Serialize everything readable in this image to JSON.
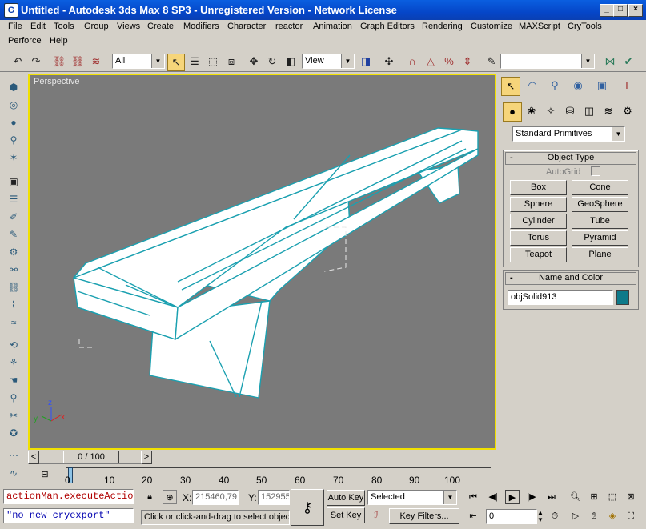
{
  "window": {
    "title": "Untitled - Autodesk 3ds Max 8 SP3  - Unregistered Version - Network License",
    "app_icon": "3ds-max-logo-icon",
    "minimize": "_",
    "maximize": "□",
    "close": "×"
  },
  "menu_row1": [
    "File",
    "Edit",
    "Tools",
    "Group",
    "Views",
    "Create",
    "Modifiers",
    "Character",
    "reactor",
    "Animation",
    "Graph Editors",
    "Rendering",
    "Customize",
    "MAXScript",
    "CryTools"
  ],
  "menu_row2": [
    "Perforce",
    "Help"
  ],
  "toolbar": {
    "selection_filter": "All",
    "reference_coord": "View",
    "named_selection": ""
  },
  "viewport": {
    "label": "Perspective",
    "axis_x": "x",
    "axis_y": "y",
    "axis_z": "z",
    "border_color": "#f0e000",
    "bg_color": "#7a7a7a",
    "object_color": "#ffffff",
    "edge_color": "#1aa0b0"
  },
  "command_panel": {
    "category_dropdown": "Standard Primitives",
    "object_type_title": "Object Type",
    "autogrid_label": "AutoGrid",
    "buttons": [
      "Box",
      "Cone",
      "Sphere",
      "GeoSphere",
      "Cylinder",
      "Tube",
      "Torus",
      "Pyramid",
      "Teapot",
      "Plane"
    ],
    "name_color_title": "Name and Color",
    "object_name": "objSolid913",
    "object_color": "#0e7a8a"
  },
  "time_slider": {
    "frame_display": "0 / 100",
    "prev": "<",
    "next": ">"
  },
  "trackbar": {
    "ticks": [
      "0",
      "10",
      "20",
      "30",
      "40",
      "50",
      "60",
      "70",
      "80",
      "90",
      "100"
    ]
  },
  "status": {
    "maxscript_line1": "actionMan.executeActio",
    "maxscript_line2": "\"no new cryexport\"",
    "x_label": "X:",
    "x_value": "215460,79",
    "y_label": "Y:",
    "y_value": "152955",
    "prompt": "Click or click-and-drag to select object",
    "auto_key": "Auto Key",
    "set_key": "Set Key",
    "selected_dropdown": "Selected",
    "key_filters": "Key Filters...",
    "frame_field": "0"
  }
}
